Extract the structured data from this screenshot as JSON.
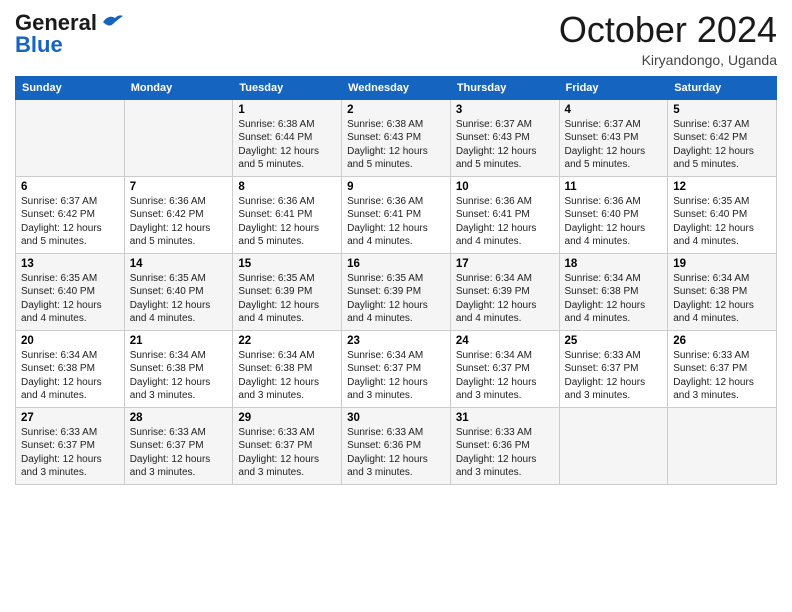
{
  "header": {
    "logo_general": "General",
    "logo_blue": "Blue",
    "month_title": "October 2024",
    "subtitle": "Kiryandongo, Uganda"
  },
  "days_of_week": [
    "Sunday",
    "Monday",
    "Tuesday",
    "Wednesday",
    "Thursday",
    "Friday",
    "Saturday"
  ],
  "weeks": [
    [
      {
        "day": "",
        "info": ""
      },
      {
        "day": "",
        "info": ""
      },
      {
        "day": "1",
        "info": "Sunrise: 6:38 AM\nSunset: 6:44 PM\nDaylight: 12 hours and 5 minutes."
      },
      {
        "day": "2",
        "info": "Sunrise: 6:38 AM\nSunset: 6:43 PM\nDaylight: 12 hours and 5 minutes."
      },
      {
        "day": "3",
        "info": "Sunrise: 6:37 AM\nSunset: 6:43 PM\nDaylight: 12 hours and 5 minutes."
      },
      {
        "day": "4",
        "info": "Sunrise: 6:37 AM\nSunset: 6:43 PM\nDaylight: 12 hours and 5 minutes."
      },
      {
        "day": "5",
        "info": "Sunrise: 6:37 AM\nSunset: 6:42 PM\nDaylight: 12 hours and 5 minutes."
      }
    ],
    [
      {
        "day": "6",
        "info": "Sunrise: 6:37 AM\nSunset: 6:42 PM\nDaylight: 12 hours and 5 minutes."
      },
      {
        "day": "7",
        "info": "Sunrise: 6:36 AM\nSunset: 6:42 PM\nDaylight: 12 hours and 5 minutes."
      },
      {
        "day": "8",
        "info": "Sunrise: 6:36 AM\nSunset: 6:41 PM\nDaylight: 12 hours and 5 minutes."
      },
      {
        "day": "9",
        "info": "Sunrise: 6:36 AM\nSunset: 6:41 PM\nDaylight: 12 hours and 4 minutes."
      },
      {
        "day": "10",
        "info": "Sunrise: 6:36 AM\nSunset: 6:41 PM\nDaylight: 12 hours and 4 minutes."
      },
      {
        "day": "11",
        "info": "Sunrise: 6:36 AM\nSunset: 6:40 PM\nDaylight: 12 hours and 4 minutes."
      },
      {
        "day": "12",
        "info": "Sunrise: 6:35 AM\nSunset: 6:40 PM\nDaylight: 12 hours and 4 minutes."
      }
    ],
    [
      {
        "day": "13",
        "info": "Sunrise: 6:35 AM\nSunset: 6:40 PM\nDaylight: 12 hours and 4 minutes."
      },
      {
        "day": "14",
        "info": "Sunrise: 6:35 AM\nSunset: 6:40 PM\nDaylight: 12 hours and 4 minutes."
      },
      {
        "day": "15",
        "info": "Sunrise: 6:35 AM\nSunset: 6:39 PM\nDaylight: 12 hours and 4 minutes."
      },
      {
        "day": "16",
        "info": "Sunrise: 6:35 AM\nSunset: 6:39 PM\nDaylight: 12 hours and 4 minutes."
      },
      {
        "day": "17",
        "info": "Sunrise: 6:34 AM\nSunset: 6:39 PM\nDaylight: 12 hours and 4 minutes."
      },
      {
        "day": "18",
        "info": "Sunrise: 6:34 AM\nSunset: 6:38 PM\nDaylight: 12 hours and 4 minutes."
      },
      {
        "day": "19",
        "info": "Sunrise: 6:34 AM\nSunset: 6:38 PM\nDaylight: 12 hours and 4 minutes."
      }
    ],
    [
      {
        "day": "20",
        "info": "Sunrise: 6:34 AM\nSunset: 6:38 PM\nDaylight: 12 hours and 4 minutes."
      },
      {
        "day": "21",
        "info": "Sunrise: 6:34 AM\nSunset: 6:38 PM\nDaylight: 12 hours and 3 minutes."
      },
      {
        "day": "22",
        "info": "Sunrise: 6:34 AM\nSunset: 6:38 PM\nDaylight: 12 hours and 3 minutes."
      },
      {
        "day": "23",
        "info": "Sunrise: 6:34 AM\nSunset: 6:37 PM\nDaylight: 12 hours and 3 minutes."
      },
      {
        "day": "24",
        "info": "Sunrise: 6:34 AM\nSunset: 6:37 PM\nDaylight: 12 hours and 3 minutes."
      },
      {
        "day": "25",
        "info": "Sunrise: 6:33 AM\nSunset: 6:37 PM\nDaylight: 12 hours and 3 minutes."
      },
      {
        "day": "26",
        "info": "Sunrise: 6:33 AM\nSunset: 6:37 PM\nDaylight: 12 hours and 3 minutes."
      }
    ],
    [
      {
        "day": "27",
        "info": "Sunrise: 6:33 AM\nSunset: 6:37 PM\nDaylight: 12 hours and 3 minutes."
      },
      {
        "day": "28",
        "info": "Sunrise: 6:33 AM\nSunset: 6:37 PM\nDaylight: 12 hours and 3 minutes."
      },
      {
        "day": "29",
        "info": "Sunrise: 6:33 AM\nSunset: 6:37 PM\nDaylight: 12 hours and 3 minutes."
      },
      {
        "day": "30",
        "info": "Sunrise: 6:33 AM\nSunset: 6:36 PM\nDaylight: 12 hours and 3 minutes."
      },
      {
        "day": "31",
        "info": "Sunrise: 6:33 AM\nSunset: 6:36 PM\nDaylight: 12 hours and 3 minutes."
      },
      {
        "day": "",
        "info": ""
      },
      {
        "day": "",
        "info": ""
      }
    ]
  ]
}
